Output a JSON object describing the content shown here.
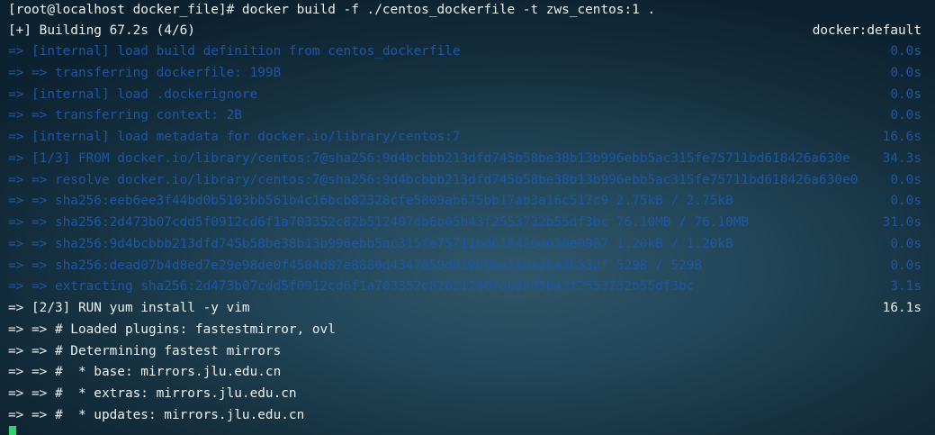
{
  "terminal": {
    "command_line": "[root@localhost docker_file]# docker build -f ./centos_dockerfile -t zws_centos:1 .",
    "status_text": "[+] Building 67.2s (4/6)",
    "context_label": "docker:default",
    "steps": [
      {
        "text": "=> [internal] load build definition from centos_dockerfile",
        "time": "0.0s",
        "state": "done"
      },
      {
        "text": "=> => transferring dockerfile: 199B",
        "time": "0.0s",
        "state": "done"
      },
      {
        "text": "=> [internal] load .dockerignore",
        "time": "0.0s",
        "state": "done"
      },
      {
        "text": "=> => transferring context: 2B",
        "time": "0.0s",
        "state": "done"
      },
      {
        "text": "=> [internal] load metadata for docker.io/library/centos:7",
        "time": "16.6s",
        "state": "done"
      },
      {
        "text": "=> [1/3] FROM docker.io/library/centos:7@sha256:9d4bcbbb213dfd745b58be38b13b996ebb5ac315fe75711bd618426a630e",
        "time": "34.3s",
        "state": "done"
      },
      {
        "text": "=> => resolve docker.io/library/centos:7@sha256:9d4bcbbb213dfd745b58be38b13b996ebb5ac315fe75711bd618426a630e0",
        "time": "0.0s",
        "state": "done"
      },
      {
        "text": "=> => sha256:eeb6ee3f44bd0b5103bb561b4c16bcb82328cfe5809ab675bb17ab3a16c517c9 2.75kB / 2.75kB",
        "time": "0.0s",
        "state": "done"
      },
      {
        "text": "=> => sha256:2d473b07cdd5f0912cd6f1a703352c82b512407db6b05b43f2553732b55df3bc 76.10MB / 76.10MB",
        "time": "31.0s",
        "state": "done"
      },
      {
        "text": "=> => sha256:9d4bcbbb213dfd745b58be38b13b996ebb5ac315fe75711bd618426a630e0987 1.20kB / 1.20kB",
        "time": "0.0s",
        "state": "done"
      },
      {
        "text": "=> => sha256:dead07b4d8ed7e29e98de0f4504d87e8880d4347859d839686a31da35a3b532f 529B / 529B",
        "time": "0.0s",
        "state": "done"
      },
      {
        "text": "=> => extracting sha256:2d473b07cdd5f0912cd6f1a703352c82b512407db6b05b43f2553732b55df3bc",
        "time": "3.1s",
        "state": "done"
      },
      {
        "text": "=> [2/3] RUN yum install -y vim",
        "time": "16.1s",
        "state": "active"
      },
      {
        "text": "=> => # Loaded plugins: fastestmirror, ovl",
        "time": "",
        "state": "active"
      },
      {
        "text": "=> => # Determining fastest mirrors",
        "time": "",
        "state": "active"
      },
      {
        "text": "=> => #  * base: mirrors.jlu.edu.cn",
        "time": "",
        "state": "active"
      },
      {
        "text": "=> => #  * extras: mirrors.jlu.edu.cn",
        "time": "",
        "state": "active"
      },
      {
        "text": "=> => #  * updates: mirrors.jlu.edu.cn",
        "time": "",
        "state": "active"
      }
    ],
    "colors": {
      "done_step": "#1d56a6",
      "active_step": "#ecf3f7",
      "cursor": "#2fd36a"
    }
  }
}
